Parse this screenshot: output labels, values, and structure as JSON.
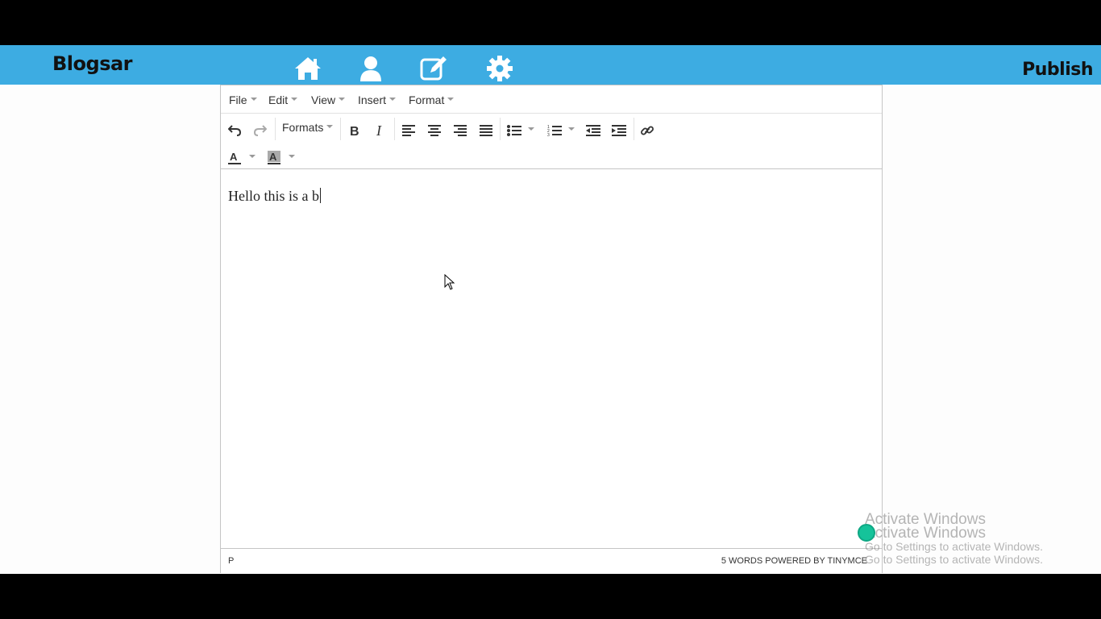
{
  "header": {
    "brand": "Blogsar",
    "publish_label": "Publish",
    "nav_icons": [
      "home-icon",
      "user-icon",
      "edit-icon",
      "settings-icon"
    ],
    "bar_color": "#3dace2"
  },
  "editor": {
    "menu": [
      "File",
      "Edit",
      "View",
      "Insert",
      "Format"
    ],
    "formats_label": "Formats",
    "content_text": "Hello this is a b",
    "status_path": "P",
    "status_right": "5 WORDS POWERED BY TINYMCE"
  },
  "watermark": {
    "line1": "Activate Windows",
    "line2": "Go to Settings to activate Windows."
  }
}
